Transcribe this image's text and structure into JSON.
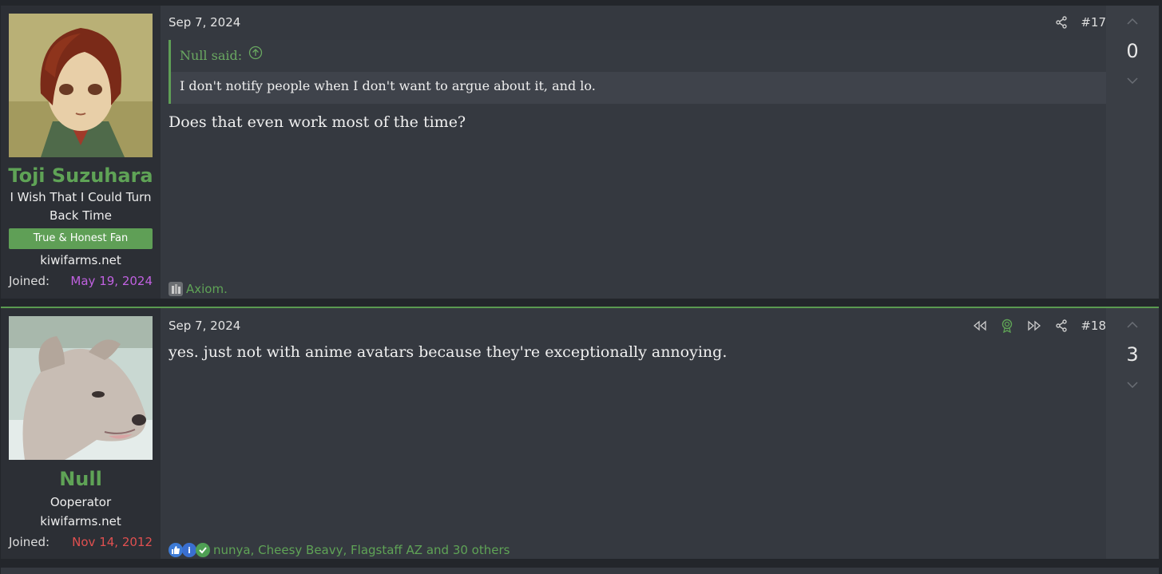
{
  "posts": [
    {
      "username": "Toji Suzuhara",
      "user_title": "I Wish That I Could Turn Back Time",
      "banner": "True & Honest Fan",
      "site": "kiwifarms.net",
      "joined_label": "Joined:",
      "joined_date": "May 19, 2024",
      "joined_color": "#c061e0",
      "date": "Sep 7, 2024",
      "post_number": "#17",
      "quote_author": "Null said:",
      "quote_text": "I don't notify people when I don't want to argue about it, and lo.",
      "message": "Does that even work most of the time?",
      "reactions_text": "Axiom.",
      "votes": "0",
      "icons": [
        "share-icon"
      ]
    },
    {
      "username": "Null",
      "user_title": "Ooperator",
      "site": "kiwifarms.net",
      "joined_label": "Joined:",
      "joined_date": "Nov 14, 2012",
      "joined_color": "#e05050",
      "date": "Sep 7, 2024",
      "post_number": "#18",
      "message": "yes. just not with anime avatars because they're exceptionally annoying.",
      "reactions_text": "nunya, Cheesy Beavy, Flagstaff AZ and 30 others",
      "votes": "3",
      "icons": [
        "jump-back-icon",
        "award-icon",
        "jump-forward-icon",
        "share-icon"
      ]
    }
  ],
  "colors": {
    "accent": "#5fa356",
    "background": "#353940"
  }
}
